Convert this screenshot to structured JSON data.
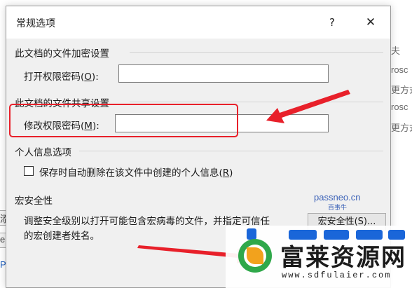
{
  "dialog": {
    "title": "常规选项",
    "help_glyph": "?",
    "close_glyph": "✕"
  },
  "encryption": {
    "header": "此文档的文件加密设置",
    "open_password_label_pre": "打开权限密码(",
    "open_password_hotkey": "O",
    "open_password_label_post": "):",
    "open_password_value": ""
  },
  "sharing": {
    "header": "此文档的文件共享设置",
    "modify_password_label_pre": "修改权限密码(",
    "modify_password_hotkey": "M",
    "modify_password_label_post": "):",
    "modify_password_value": ""
  },
  "privacy": {
    "header": "个人信息选项",
    "remove_info_label_pre": "保存时自动删除在该文件中创建的个人信息(",
    "remove_info_hotkey": "R",
    "remove_info_label_post": ")",
    "remove_info_checked": false
  },
  "macro": {
    "header": "宏安全性",
    "description_line1": "调整安全级别以打开可能包含宏病毒的文件，并指定可信任",
    "description_line2": "的宏创建者姓名。",
    "button_label": "宏安全性(S)..."
  },
  "background": {
    "right_fragments": [
      "夫",
      "rosc",
      "更方式",
      "rosc",
      "更方式"
    ],
    "left_fragments": [
      "添加",
      "er",
      "P"
    ]
  },
  "watermarks": {
    "site": "passneo.cn",
    "site_sub": "百事牛",
    "logo_main": "富莱资源网",
    "logo_url": "www.sdfulaier.com"
  },
  "colors": {
    "annotation_red": "#e8202a",
    "logo_green": "#2fa84a",
    "watermark_blue": "#3d63b8"
  }
}
